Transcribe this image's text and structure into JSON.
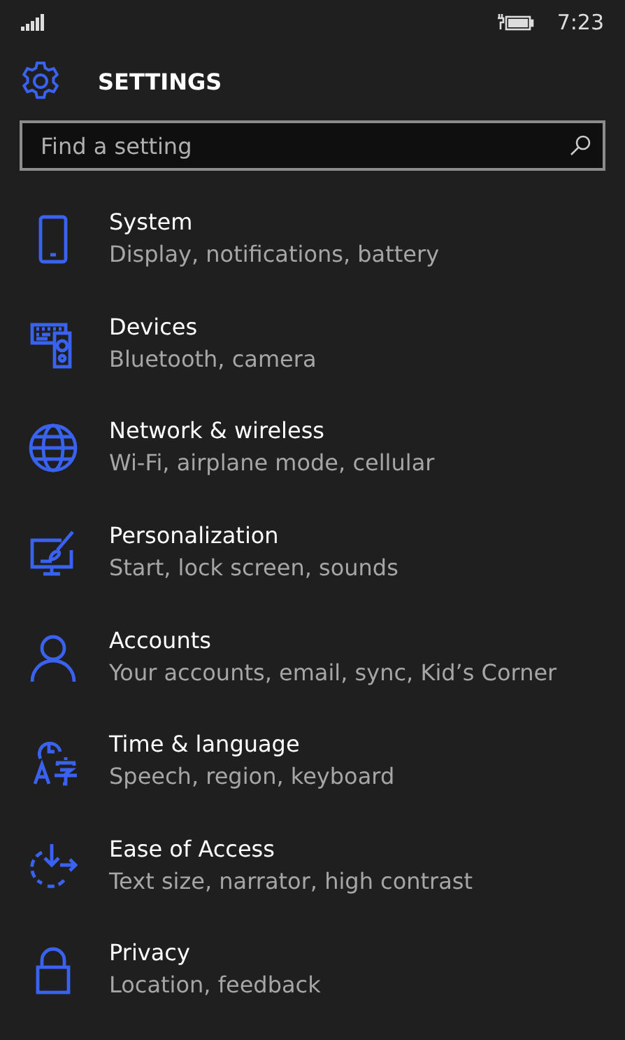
{
  "status_bar": {
    "time": "7:23"
  },
  "header": {
    "title": "SETTINGS"
  },
  "search": {
    "placeholder": "Find a setting"
  },
  "categories": [
    {
      "kind": "phone",
      "title": "System",
      "subtitle": "Display, notifications, battery"
    },
    {
      "kind": "devices",
      "title": "Devices",
      "subtitle": "Bluetooth, camera"
    },
    {
      "kind": "globe",
      "title": "Network & wireless",
      "subtitle": "Wi-Fi, airplane mode, cellular"
    },
    {
      "kind": "brush",
      "title": "Personalization",
      "subtitle": "Start, lock screen, sounds"
    },
    {
      "kind": "person",
      "title": "Accounts",
      "subtitle": "Your accounts, email, sync, Kid’s Corner"
    },
    {
      "kind": "clock",
      "title": "Time & language",
      "subtitle": "Speech, region, keyboard"
    },
    {
      "kind": "ease",
      "title": "Ease of Access",
      "subtitle": "Text size, narrator, high contrast"
    },
    {
      "kind": "lock",
      "title": "Privacy",
      "subtitle": "Location, feedback"
    }
  ]
}
